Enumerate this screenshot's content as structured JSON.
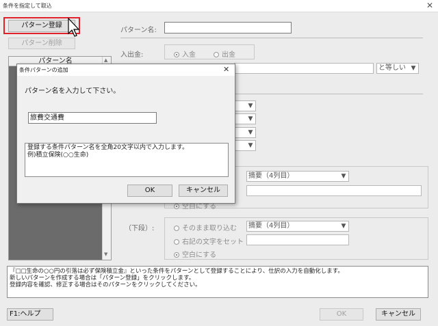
{
  "window": {
    "title": "条件を指定して取込",
    "close_glyph": "✕"
  },
  "toolbar": {
    "register_pattern": "パターン登録",
    "delete_pattern": "パターン削除"
  },
  "pattern_list": {
    "header": "パターン名",
    "scroll_up": "▲",
    "scroll_down": "▼"
  },
  "form": {
    "pattern_name_label": "パターン名:",
    "pattern_name_value": "",
    "in_out_label": "入出金:",
    "in_out_options": [
      "入金",
      "出金"
    ],
    "in_out_selected": "入金",
    "compare_value": "と等しい",
    "dropdown_arrow": "▼"
  },
  "upper_section": {
    "column_value": "摘要（4列目）",
    "option_blank": "空白にする"
  },
  "lower_section": {
    "label": "（下段）:",
    "options": [
      "そのまま取り込む",
      "右記の文字をセット",
      "空白にする"
    ],
    "selected": "空白にする",
    "column_value": "摘要（4列目）"
  },
  "info_text": [
    "『□□生命の○○円の引落は必ず保険積立金』といった条件をパターンとして登録することにより、仕訳の入力を自動化します。",
    "新しいパターンを作成する場合は「パターン登録」をクリックします。",
    "登録内容を確認、修正する場合はそのパターンをクリックしてください。"
  ],
  "footer": {
    "help": "F1:ヘルプ",
    "ok": "OK",
    "cancel": "キャンセル"
  },
  "dialog": {
    "title": "条件パターンの追加",
    "close_glyph": "✕",
    "prompt": "パターン名を入力して下さい。",
    "input_value": "旅費交通費",
    "help_lines": [
      "登録する条件パターン名を全角20文字以内で入力します。",
      "例)積立保険(○○生命)"
    ],
    "ok": "OK",
    "cancel": "キャンセル"
  },
  "colors": {
    "highlight_border": "#e0202a",
    "list_bg": "#6b6b6b",
    "window_bg": "#ececec"
  }
}
